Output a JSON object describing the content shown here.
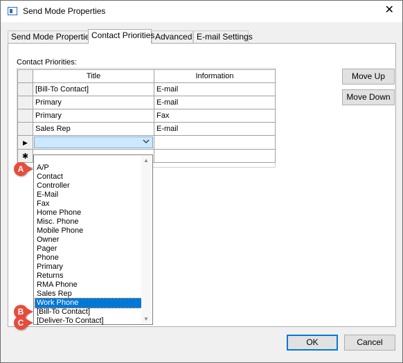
{
  "window": {
    "title": "Send Mode Properties",
    "close_glyph": "✕"
  },
  "tabs": [
    {
      "label": "Send Mode Properties"
    },
    {
      "label": "Contact Priorities"
    },
    {
      "label": "Advanced"
    },
    {
      "label": "E-mail Settings"
    }
  ],
  "section_label": "Contact Priorities:",
  "grid": {
    "columns": [
      "Title",
      "Information"
    ],
    "rows": [
      {
        "title": "[Bill-To Contact]",
        "info": "E-mail"
      },
      {
        "title": "Primary",
        "info": "E-mail"
      },
      {
        "title": "Primary",
        "info": "Fax"
      },
      {
        "title": "Sales Rep",
        "info": "E-mail"
      }
    ],
    "current_row_marker": "▶",
    "new_row_marker": "✱"
  },
  "buttons": {
    "move_up": "Move Up",
    "move_down": "Move Down",
    "ok": "OK",
    "cancel": "Cancel"
  },
  "dropdown": {
    "options": [
      "A/P",
      "Contact",
      "Controller",
      "E-Mail",
      "Fax",
      "Home Phone",
      "Misc. Phone",
      "Mobile Phone",
      "Owner",
      "Pager",
      "Phone",
      "Primary",
      "Returns",
      "RMA Phone",
      "Sales Rep",
      "Work Phone",
      "[Bill-To Contact]",
      "[Deliver-To Contact]"
    ],
    "selected_index": 15
  },
  "annotations": [
    "A",
    "B",
    "C"
  ],
  "colors": {
    "selection": "#0078d7",
    "badge": "#e74c3c",
    "combo_bg": "#cce8ff"
  }
}
